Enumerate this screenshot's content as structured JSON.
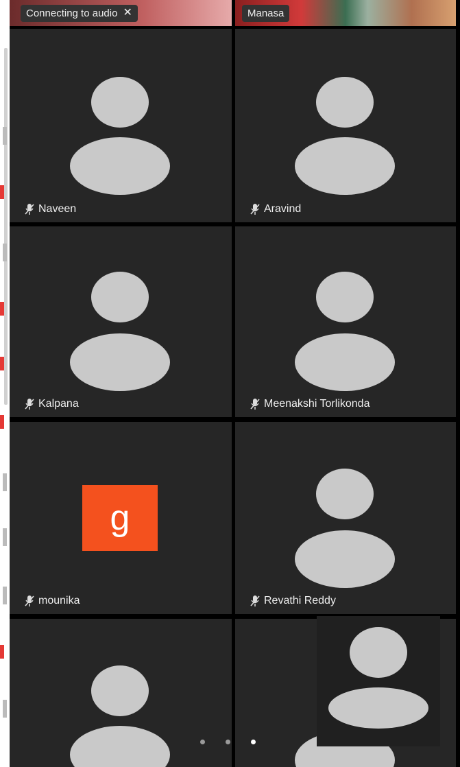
{
  "banner_left": {
    "label": "Connecting to audio",
    "close_icon": "close-icon"
  },
  "banner_right": {
    "label": "Manasa"
  },
  "participants": [
    {
      "name": "Naveen"
    },
    {
      "name": "Aravind"
    },
    {
      "name": "Kalpana"
    },
    {
      "name": "Meenakshi Torlikonda"
    },
    {
      "name": "mounika",
      "initial": "g",
      "avatar_color": "#f4511e"
    },
    {
      "name": "Revathi Reddy"
    }
  ],
  "pager": {
    "pages": 3,
    "active": 3
  },
  "colors": {
    "tile_bg": "#262626",
    "avatar": "#c9c9c9",
    "accent": "#f4511e"
  }
}
